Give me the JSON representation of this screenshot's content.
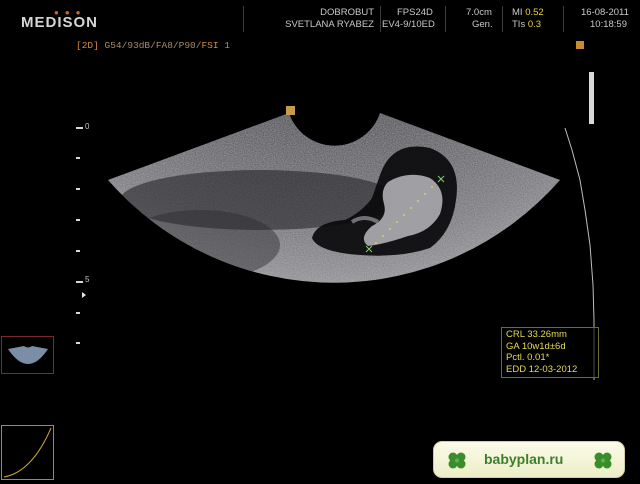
{
  "header": {
    "brand": "MEDISON",
    "clinic": "DOBROBUT",
    "patient": "SVETLANA RYABEZ",
    "fps": "FPS24D",
    "probe": "EV4-9/10ED",
    "depth": "7.0cm",
    "preset": "Gen.",
    "mi_label": "MI",
    "mi_value": "0.52",
    "tis_label": "TIs",
    "tis_value": "0.3",
    "date": "16-08-2011",
    "time": "10:18:59"
  },
  "imaging_params": {
    "mode": "[2D]",
    "settings": "G54/93dB/FA8/P90/",
    "fsi": "FSI 1"
  },
  "depth_scale": {
    "labels": [
      "0",
      "5"
    ]
  },
  "measurement": {
    "crl": "CRL 33.26mm",
    "ga": "GA 10w1d±6d",
    "pctl": "Pctl. 0.01*",
    "edd": "EDD 12-03-2012"
  },
  "watermark": {
    "text": "babyplan.ru"
  },
  "colors": {
    "logo_dots": "#d06a2a",
    "mode_text": "#d58a3c",
    "measure_text": "#e7dc4e",
    "banner_text": "#3d7f2c"
  }
}
